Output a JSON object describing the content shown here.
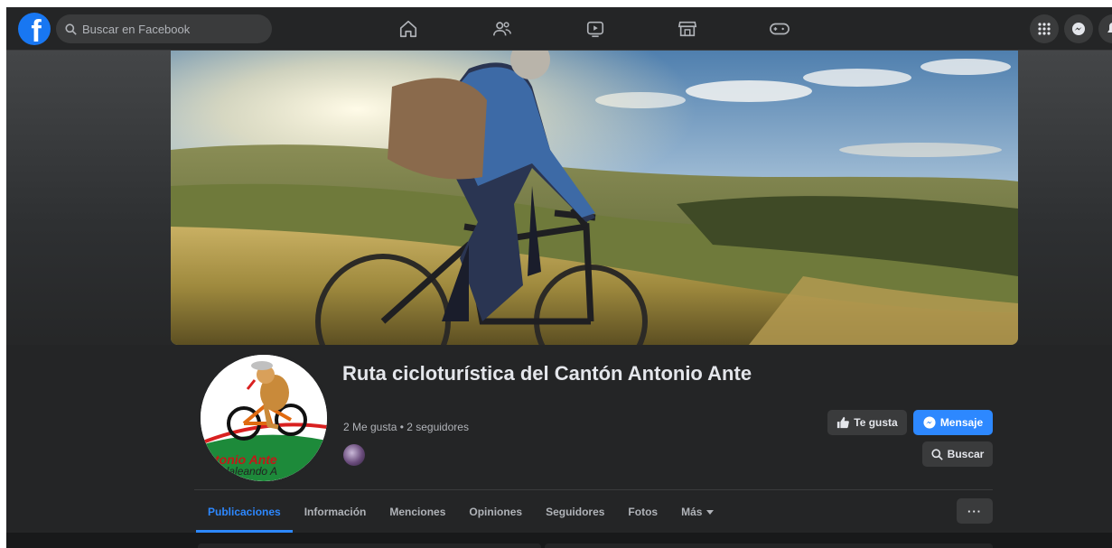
{
  "topbar": {
    "logo_letter": "f",
    "search_placeholder": "Buscar en Facebook",
    "nav_icons": [
      "home-icon",
      "friends-icon",
      "watch-icon",
      "marketplace-icon",
      "gaming-icon"
    ],
    "right_icons": [
      "menu-grid-icon",
      "messenger-icon",
      "notifications-icon"
    ]
  },
  "page": {
    "title": "Ruta cicloturística del Cantón Antonio Ante",
    "stats": "2 Me gusta • 2 seguidores",
    "avatar_logo_text_1": "tonio Ante",
    "avatar_logo_text_2": "edaleando A",
    "cover_subject": "cyclist on mountain bike on grassy hills at sunset"
  },
  "actions": {
    "like_label": "Te gusta",
    "message_label": "Mensaje",
    "search_label": "Buscar",
    "more_label": "···"
  },
  "tabs": [
    {
      "label": "Publicaciones",
      "active": true
    },
    {
      "label": "Información",
      "active": false
    },
    {
      "label": "Menciones",
      "active": false
    },
    {
      "label": "Opiniones",
      "active": false
    },
    {
      "label": "Seguidores",
      "active": false
    },
    {
      "label": "Fotos",
      "active": false
    },
    {
      "label": "Más",
      "active": false
    }
  ],
  "colors": {
    "accent": "#2d88ff",
    "brand": "#1877f2",
    "surface": "#242526",
    "background": "#18191a",
    "text_primary": "#e4e6eb",
    "text_secondary": "#b0b3b8"
  }
}
